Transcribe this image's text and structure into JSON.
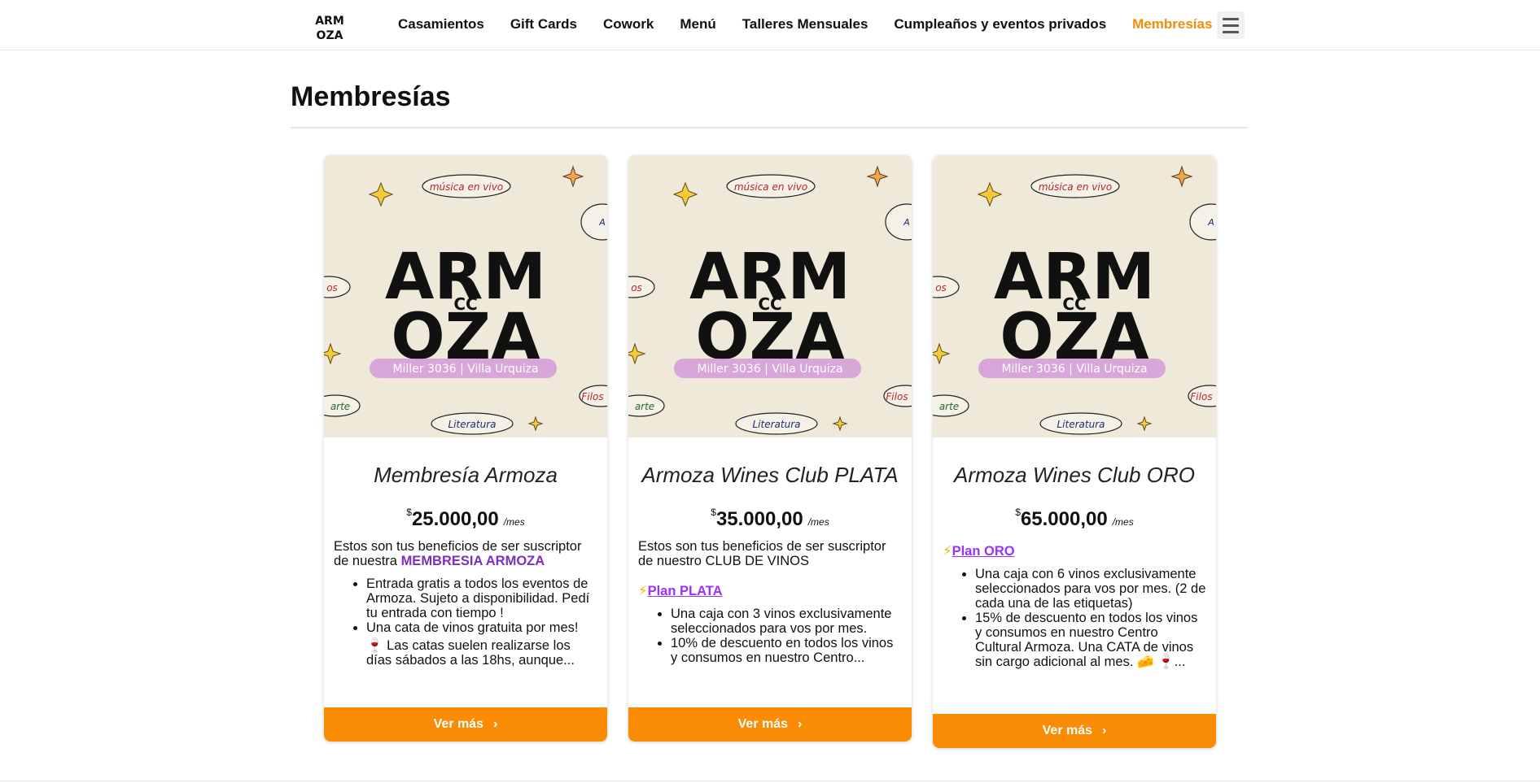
{
  "header": {
    "logo_text": "ARM OZA",
    "nav": [
      "Casamientos",
      "Gift Cards",
      "Cowork",
      "Menú",
      "Talleres Mensuales",
      "Cumpleaños y eventos privados",
      "Membresías"
    ]
  },
  "page": {
    "title": "Membresías"
  },
  "card_image": {
    "tags": [
      "música en vivo",
      "Literatura",
      "arte",
      "Filos",
      "os",
      "A"
    ],
    "logo_line1": "ARM",
    "logo_cc": "CC",
    "logo_line2": "OZA",
    "address": "Miller 3036 | Villa Urquiza"
  },
  "cards": [
    {
      "name": "Membresía Armoza",
      "currency": "$",
      "price": "25.000,00",
      "period": "/mes",
      "intro": "Estos son tus beneficios de ser suscriptor de nuestra ",
      "intro_highlight": "MEMBRESIA ARMOZA",
      "benefits": [
        "Entrada gratis a todos los eventos de Armoza. Sujeto a disponibilidad. Pedí tu entrada con tiempo !",
        "Una cata de vinos gratuita por mes!",
        "🍷 Las catas suelen realizarse los días sábados a las 18hs, aunque..."
      ],
      "cta": "Ver más"
    },
    {
      "name": "Armoza Wines Club PLATA",
      "currency": "$",
      "price": "35.000,00",
      "period": "/mes",
      "intro": "Estos son tus beneficios de ser suscriptor de nuestro CLUB DE VINOS",
      "plan_icon": "⚡",
      "plan_link": "Plan PLATA",
      "benefits": [
        "Una caja con 3 vinos exclusivamente seleccionados para vos por mes.",
        "10% de descuento en todos los vinos y consumos en nuestro Centro..."
      ],
      "cta": "Ver más"
    },
    {
      "name": "Armoza Wines Club ORO",
      "currency": "$",
      "price": "65.000,00",
      "period": "/mes",
      "plan_icon": "⚡",
      "plan_link": "Plan ORO",
      "benefits": [
        "Una caja con 6 vinos exclusivamente seleccionados para vos por mes. (2 de cada una de las etiquetas)",
        "15% de descuento en todos los vinos y consumos en nuestro Centro Cultural Armoza. Una CATA de vinos sin cargo adicional al mes. 🧀 🍷..."
      ],
      "cta": "Ver más"
    }
  ],
  "colors": {
    "accent": "#f98b05",
    "active_nav": "#f28b0c",
    "highlight": "#7b2fbf",
    "link": "#9b30ff",
    "card_bg": "#efe9d9"
  },
  "icons": {
    "menu": "hamburger-icon",
    "cta": "chevron-right-icon"
  }
}
